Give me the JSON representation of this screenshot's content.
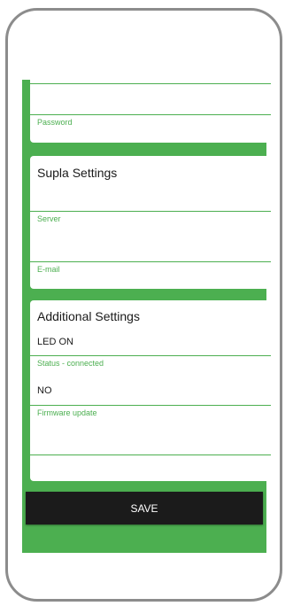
{
  "password_section": {
    "password_label": "Password"
  },
  "supla": {
    "title": "Supla Settings",
    "server_label": "Server",
    "email_label": "E-mail"
  },
  "additional": {
    "title": "Additional Settings",
    "led_value": "LED ON",
    "status_label": "Status - connected",
    "status_value": "NO",
    "firmware_label": "Firmware update"
  },
  "save_label": "SAVE",
  "colors": {
    "accent": "#4caf50",
    "button": "#1b1b1b",
    "frame": "#8c8c8c"
  }
}
